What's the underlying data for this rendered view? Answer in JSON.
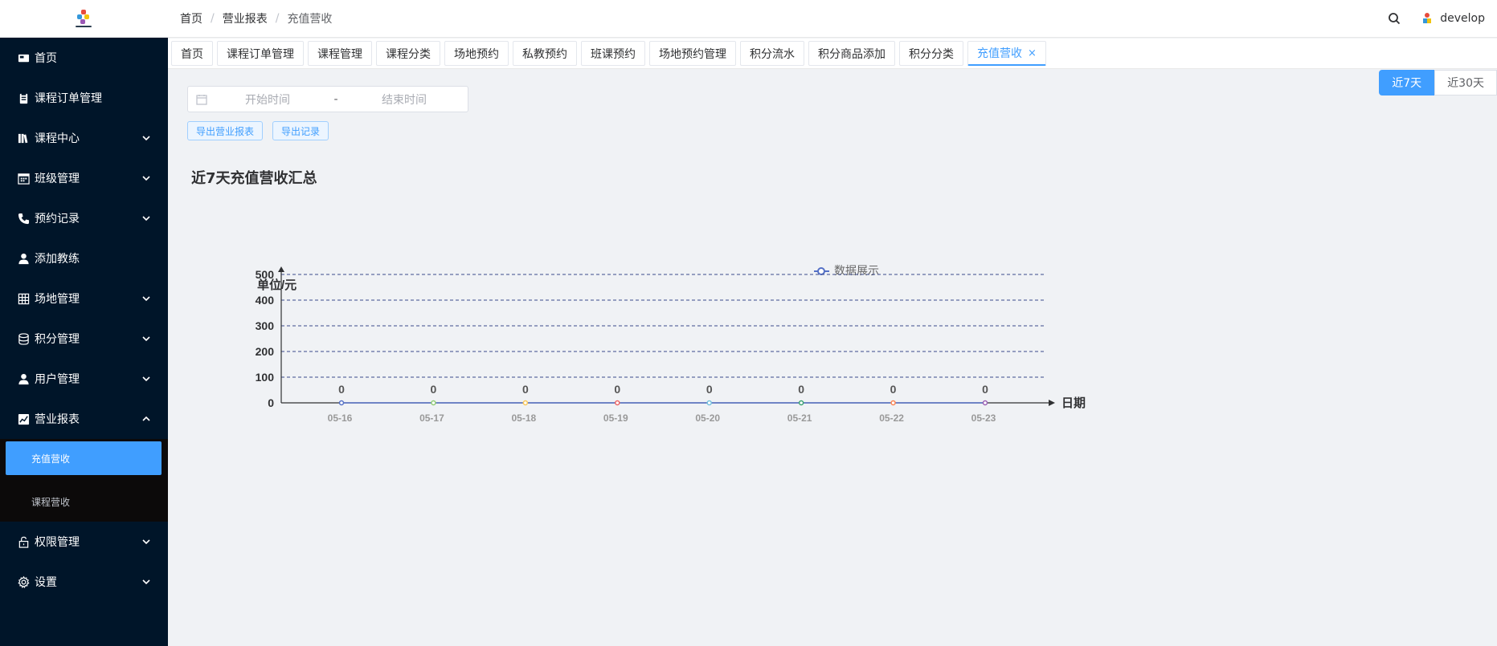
{
  "sidebar": {
    "items": [
      {
        "label": "首页",
        "icon": "dashboard-icon",
        "has_children": false
      },
      {
        "label": "课程订单管理",
        "icon": "clipboard-icon",
        "has_children": false
      },
      {
        "label": "课程中心",
        "icon": "books-icon",
        "has_children": true
      },
      {
        "label": "班级管理",
        "icon": "calendar-grid-icon",
        "has_children": true
      },
      {
        "label": "预约记录",
        "icon": "phone-icon",
        "has_children": true
      },
      {
        "label": "添加教练",
        "icon": "user-icon",
        "has_children": false
      },
      {
        "label": "场地管理",
        "icon": "grid-icon",
        "has_children": true
      },
      {
        "label": "积分管理",
        "icon": "database-icon",
        "has_children": true
      },
      {
        "label": "用户管理",
        "icon": "user-icon",
        "has_children": true
      },
      {
        "label": "营业报表",
        "icon": "chart-icon",
        "has_children": true,
        "expanded": true
      },
      {
        "label": "权限管理",
        "icon": "lock-icon",
        "has_children": true
      },
      {
        "label": "设置",
        "icon": "gear-icon",
        "has_children": true
      }
    ],
    "report_sub": [
      {
        "label": "充值营收",
        "active": true
      },
      {
        "label": "课程营收",
        "active": false
      }
    ]
  },
  "header": {
    "breadcrumb": [
      "首页",
      "营业报表",
      "充值营收"
    ],
    "username": "develop"
  },
  "tabs": [
    "首页",
    "课程订单管理",
    "课程管理",
    "课程分类",
    "场地预约",
    "私教预约",
    "班课预约",
    "场地预约管理",
    "积分流水",
    "积分商品添加",
    "积分分类",
    "充值营收"
  ],
  "active_tab": "充值营收",
  "filter": {
    "start_placeholder": "开始时间",
    "separator": "-",
    "end_placeholder": "结束时间",
    "export_report": "导出营业报表",
    "export_record": "导出记录"
  },
  "range_toggle": {
    "days7": "近7天",
    "days30": "近30天"
  },
  "colors": {
    "primary": "#409eff",
    "sidebar": "#001529",
    "series": "#5470c6"
  },
  "chart_data": {
    "type": "line",
    "title": "近7天充值营收汇总",
    "legend": "数据展示",
    "ylabel": "单位/元",
    "xlabel": "日期",
    "ylim": [
      0,
      500
    ],
    "yticks": [
      0,
      100,
      200,
      300,
      400,
      500
    ],
    "categories": [
      "05-16",
      "05-17",
      "05-18",
      "05-19",
      "05-20",
      "05-21",
      "05-22",
      "05-23"
    ],
    "series": [
      {
        "name": "数据展示",
        "values": [
          0,
          0,
          0,
          0,
          0,
          0,
          0,
          0
        ]
      }
    ],
    "point_colors": [
      "#5470c6",
      "#91cc75",
      "#fac858",
      "#ee6666",
      "#73c0de",
      "#3ba272",
      "#fc8452",
      "#9a60b4"
    ],
    "grid": true,
    "legend_position": "top-center"
  }
}
